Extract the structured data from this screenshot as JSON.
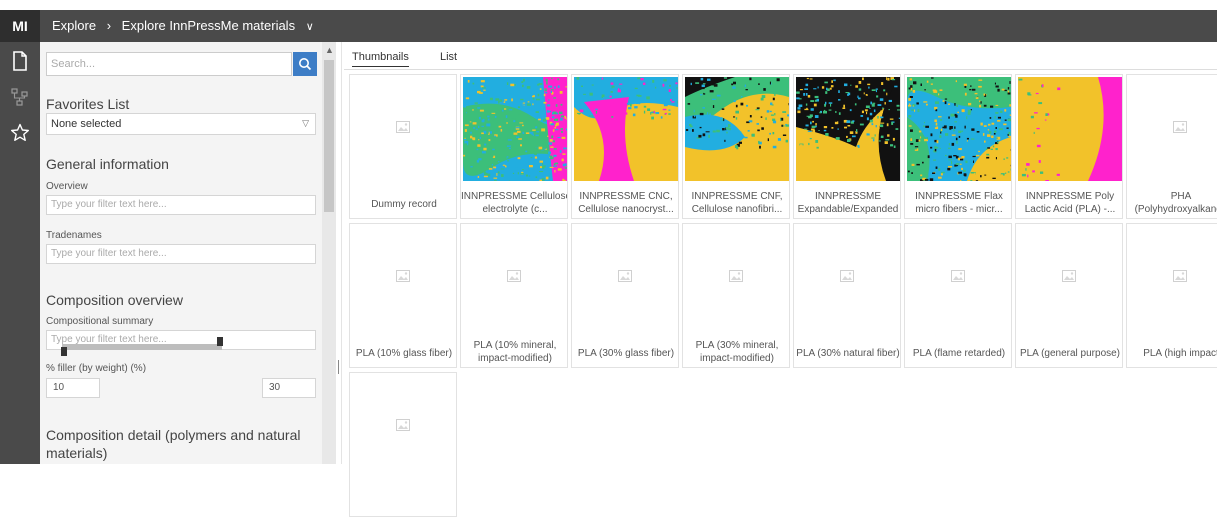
{
  "app": {
    "logo": "MI",
    "breadcrumb": [
      {
        "label": "Explore"
      },
      {
        "label": "Explore InnPressMe materials"
      }
    ]
  },
  "rail": {
    "icons": [
      "document-icon",
      "hierarchy-icon",
      "star-icon"
    ]
  },
  "filters": {
    "search_placeholder": "Search...",
    "favorites": {
      "title": "Favorites List",
      "selected": "None selected"
    },
    "general": {
      "title": "General information",
      "overview_label": "Overview",
      "overview_placeholder": "Type your filter text here...",
      "tradenames_label": "Tradenames",
      "tradenames_placeholder": "Type your filter text here..."
    },
    "composition": {
      "title": "Composition overview",
      "summary_label": "Compositional summary",
      "summary_placeholder": "Type your filter text here...",
      "filler_label": "% filler (by weight) (%)",
      "filler_min": "10",
      "filler_max": "30"
    },
    "detail": {
      "title_line1": "Composition detail (polymers and natural",
      "title_line2": "materials)"
    }
  },
  "view_tabs": [
    {
      "label": "Thumbnails",
      "active": true
    },
    {
      "label": "List",
      "active": false
    }
  ],
  "records": [
    {
      "line1": "",
      "line2": "Dummy record",
      "image": "placeholder"
    },
    {
      "line1": "INNPRESSME Cellulose",
      "line2": "electrolyte (c...",
      "image": "map-green-blue"
    },
    {
      "line1": "INNPRESSME CNC,",
      "line2": "Cellulose nanocryst...",
      "image": "map-magenta-yellow"
    },
    {
      "line1": "INNPRESSME CNF,",
      "line2": "Cellulose nanofibri...",
      "image": "map-green-yellow"
    },
    {
      "line1": "INNPRESSME",
      "line2": "Expandable/Expanded",
      "image": "map-black-yellow"
    },
    {
      "line1": "INNPRESSME Flax",
      "line2": "micro fibers - micr...",
      "image": "map-green-blue-2"
    },
    {
      "line1": "INNPRESSME Poly",
      "line2": "Lactic Acid (PLA) -...",
      "image": "map-yellow-magenta"
    },
    {
      "line1": "PHA",
      "line2": "(Polyhydroxyalkanoa",
      "image": "placeholder"
    },
    {
      "line1": "",
      "line2": "PLA (10% glass fiber)",
      "image": "placeholder"
    },
    {
      "line1": "PLA (10% mineral,",
      "line2": "impact-modified)",
      "image": "placeholder"
    },
    {
      "line1": "",
      "line2": "PLA (30% glass fiber)",
      "image": "placeholder"
    },
    {
      "line1": "PLA (30% mineral,",
      "line2": "impact-modified)",
      "image": "placeholder"
    },
    {
      "line1": "",
      "line2": "PLA (30% natural fiber)",
      "image": "placeholder"
    },
    {
      "line1": "",
      "line2": "PLA (flame retarded)",
      "image": "placeholder"
    },
    {
      "line1": "",
      "line2": "PLA (general purpose)",
      "image": "placeholder"
    },
    {
      "line1": "",
      "line2": "PLA (high impact",
      "image": "placeholder"
    },
    {
      "line1": "",
      "line2": "",
      "image": "placeholder"
    }
  ],
  "colors": {
    "topbar": "#4a4a4a",
    "accent": "#3d7dc6",
    "map_cyan": "#22aee0",
    "map_yellow": "#f2c22a",
    "map_green": "#3cbf7a",
    "map_magenta": "#ff22cc",
    "map_black": "#111111"
  }
}
